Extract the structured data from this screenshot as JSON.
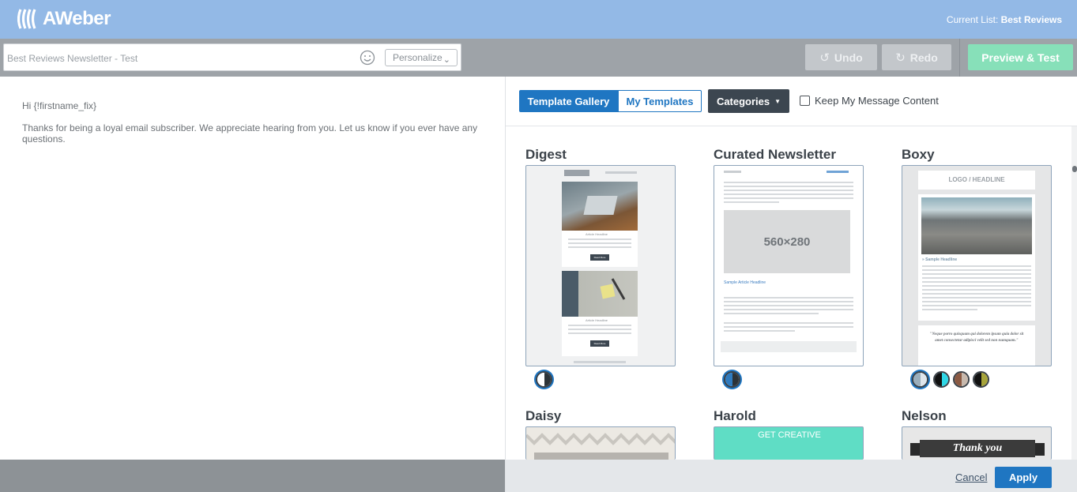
{
  "header": {
    "brand": "AWeber",
    "current_list_label": "Current List:",
    "current_list_value": "Best Reviews"
  },
  "toolbar": {
    "subject_value": "Best Reviews Newsletter - Test",
    "emoji_icon": "smiley-icon",
    "personalize_label": "Personalize",
    "undo_label": "Undo",
    "redo_label": "Redo",
    "preview_label": "Preview & Test"
  },
  "editor": {
    "greeting": "Hi {!firstname_fix}",
    "body": "Thanks for being a loyal email subscriber. We appreciate hearing from you. Let us know if you ever have any questions."
  },
  "panel": {
    "tabs": [
      {
        "label": "Template Gallery",
        "active": true
      },
      {
        "label": "My Templates",
        "active": false
      }
    ],
    "categories_label": "Categories",
    "keep_content_label": "Keep My Message Content",
    "keep_content_checked": false,
    "templates": [
      {
        "name": "Digest",
        "thumb_text": [
          "Read More",
          "Read More",
          "Article Headline",
          "Article Headline"
        ]
      },
      {
        "name": "Curated Newsletter",
        "thumb_text": [
          "560×280",
          "Sample Article Headline"
        ]
      },
      {
        "name": "Boxy",
        "thumb_text": [
          "LOGO / HEADLINE",
          "» Sample Headline",
          "\"Neque porro quisquam qui dolorem ipsum quia dolor sit amet consectetur adipisci velit sed non numquam.\""
        ]
      },
      {
        "name": "Daisy"
      },
      {
        "name": "Harold",
        "thumb_text": [
          "GET CREATIVE"
        ]
      },
      {
        "name": "Nelson",
        "thumb_text": [
          "Thank you"
        ]
      }
    ],
    "cancel_label": "Cancel",
    "apply_label": "Apply"
  },
  "colors": {
    "header_bg": "#93b9e6",
    "toolbar_bg": "#9ea3a8",
    "accent_blue": "#1f76c2",
    "preview_green": "#87e0b9",
    "harold_teal": "#5fddc5"
  }
}
